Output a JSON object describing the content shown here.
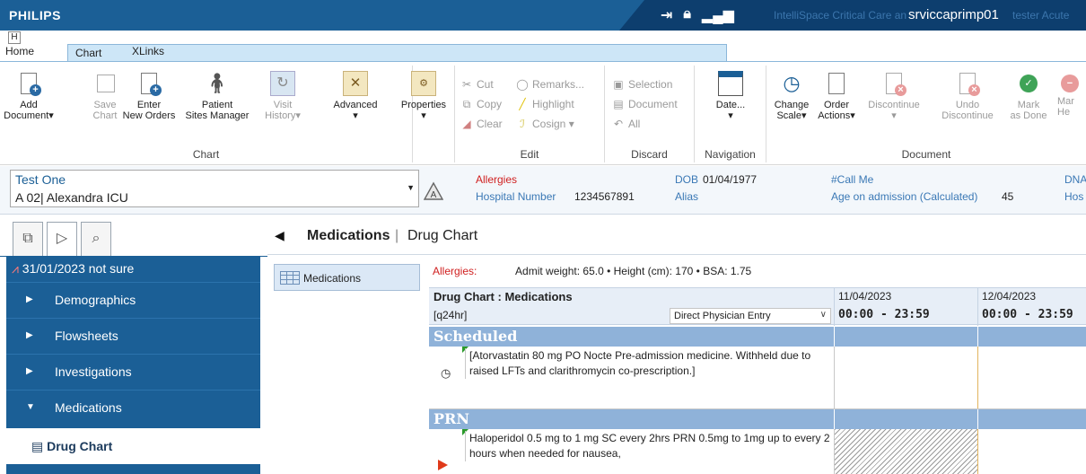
{
  "titlebar": {
    "brand": "PHILIPS",
    "product": "IntelliSpace Critical Care an",
    "server": "srviccaprimp01",
    "faded_tail": "tester Acute",
    "bg_color": "#1b5f96"
  },
  "ribbon_tabs": {
    "home": "Home",
    "chart": "Chart",
    "xlinks": "XLinks",
    "keytip": "H"
  },
  "ribbon": {
    "chart_group": {
      "label": "Chart",
      "add_document": [
        "Add",
        "Document▾"
      ],
      "save_chart": [
        "Save",
        "Chart"
      ],
      "enter_new_orders": [
        "Enter",
        "New Orders"
      ],
      "patient_sites_manager": [
        "Patient",
        "Sites Manager"
      ],
      "visit_history": [
        "Visit",
        "History▾"
      ],
      "advanced": [
        "Advanced",
        "▾"
      ]
    },
    "properties": [
      "Properties",
      "▾"
    ],
    "edit_group": {
      "label": "Edit",
      "cut": "Cut",
      "copy": "Copy",
      "clear": "Clear",
      "remarks": "Remarks...",
      "highlight": "Highlight",
      "cosign": "Cosign ▾"
    },
    "discard_group": {
      "label": "Discard",
      "selection": "Selection",
      "document": "Document",
      "all": "All"
    },
    "navigation_group": {
      "label": "Navigation",
      "date": [
        "Date...",
        "▾"
      ]
    },
    "document_group": {
      "label": "Document",
      "change_scale": [
        "Change",
        "Scale▾"
      ],
      "order_actions": [
        "Order",
        "Actions▾"
      ],
      "discontinue": [
        "Discontinue",
        "▾"
      ],
      "undo_discontinue": [
        "Undo",
        "Discontinue"
      ],
      "mark_as_done": [
        "Mark",
        "as Done"
      ],
      "mark_he": [
        "Mar",
        "He"
      ]
    }
  },
  "patient": {
    "name": "Test One",
    "location": "A 02| Alexandra ICU",
    "allergies_label": "Allergies",
    "hospital_number_label": "Hospital Number",
    "hospital_number": "1234567891",
    "dob_label": "DOB",
    "dob": "01/04/1977",
    "alias_label": "Alias",
    "call_me": "#Call Me",
    "age_label": "Age on admission (Calculated)",
    "age": "45",
    "dna": "DNA",
    "hos": "Hos"
  },
  "leftnav": {
    "date_entry": "31/01/2023 not sure",
    "items": [
      "Demographics",
      "Flowsheets",
      "Investigations",
      "Medications"
    ],
    "selected_sub": "Drug Chart"
  },
  "content": {
    "breadcrumb_main": "Medications",
    "breadcrumb_sep": "|",
    "breadcrumb_sub": "Drug Chart",
    "meds_button": "Medications",
    "allergies_label": "Allergies:",
    "measurements": "Admit weight: 65.0 • Height (cm): 170 • BSA: 1.75",
    "header_title": "Drug Chart : Medications",
    "frequency": "[q24hr]",
    "entry_select": "Direct Physician Entry",
    "dates": [
      {
        "date": "11/04/2023",
        "time": "00:00 - 23:59"
      },
      {
        "date": "12/04/2023",
        "time": "00:00 - 23:59"
      }
    ],
    "sections": {
      "scheduled": "Scheduled",
      "prn": "PRN"
    },
    "scheduled_med": "[Atorvastatin 80 mg PO Nocte Pre-admission medicine. Withheld due to raised LFTs and clarithromycin co-prescription.]",
    "prn_med": "Haloperidol 0.5 mg to 1 mg SC every 2hrs PRN 0.5mg to 1mg up to every 2 hours when needed for nausea,"
  }
}
